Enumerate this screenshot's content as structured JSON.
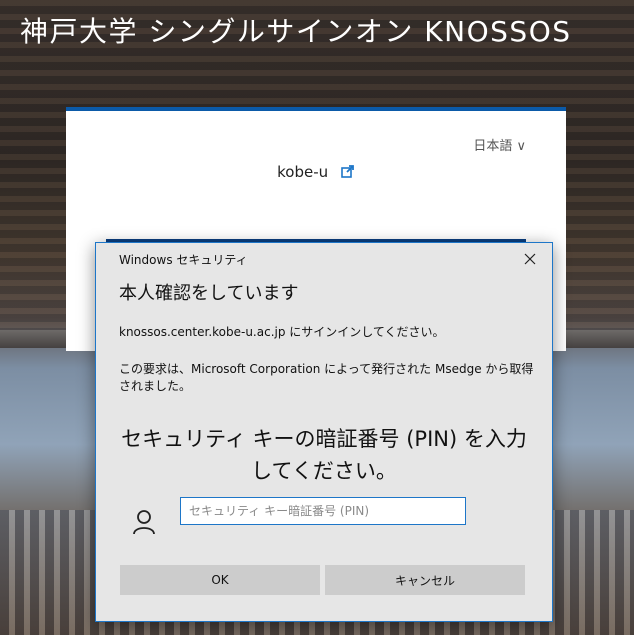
{
  "site": {
    "title": "神戸大学 シングルサインオン KNOSSOS"
  },
  "login_card": {
    "language": "日本語 ∨",
    "org_name": "kobe-u",
    "external_link_icon": "external-link-icon",
    "accent_color": "#0b5aa8"
  },
  "dialog": {
    "caption": "Windows セキュリティ",
    "close_icon": "close-icon",
    "heading": "本人確認をしています",
    "message1": "knossos.center.kobe-u.ac.jp にサインインしてください。",
    "message2": "この要求は、Microsoft Corporation によって発行された Msedge から取得されました。",
    "pin_title": "セキュリティ キーの暗証番号 (PIN) を入力してください。",
    "user_icon": "user-icon",
    "pin_placeholder": "セキュリティ キー暗証番号 (PIN)",
    "pin_value": "",
    "ok_label": "OK",
    "cancel_label": "キャンセル",
    "border_color": "#1d76c8"
  }
}
